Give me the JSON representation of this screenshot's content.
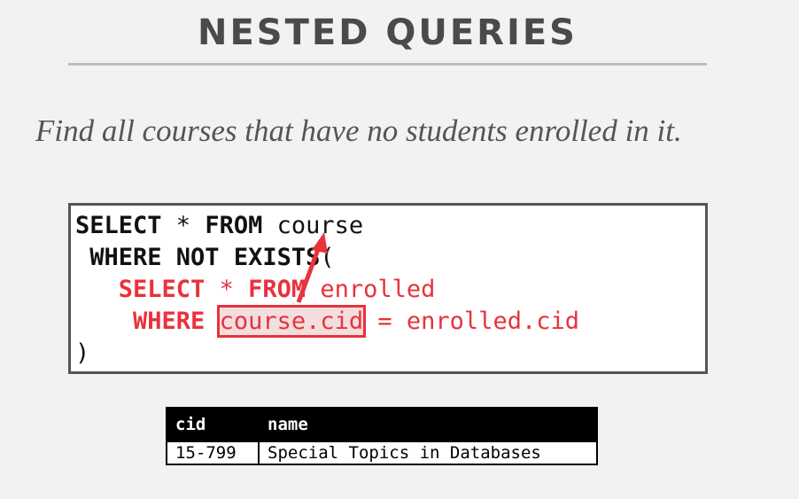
{
  "slide": {
    "title": "NESTED QUERIES",
    "subtitle": "Find all courses that have no students enrolled in it."
  },
  "code": {
    "line1": {
      "kw1": "SELECT",
      "star": " * ",
      "kw2": "FROM",
      "rest": " course"
    },
    "line2": {
      "indent": " ",
      "kw": "WHERE NOT EXISTS",
      "rest": "("
    },
    "line3": {
      "indent": "   ",
      "kw1": "SELECT",
      "star": " * ",
      "kw2": "FROM",
      "rest": " enrolled"
    },
    "line4": {
      "indent": "    ",
      "kw": "WHERE",
      "sp": " ",
      "highlight": "course.cid",
      "rest": " = enrolled.cid"
    },
    "line5": ")",
    "colors": {
      "keyword": "#111111",
      "inner": "#e8323c",
      "arrow": "#e8323c"
    }
  },
  "result_table": {
    "columns": [
      "cid",
      "name"
    ],
    "rows": [
      [
        "15-799",
        "Special Topics in Databases"
      ]
    ]
  }
}
